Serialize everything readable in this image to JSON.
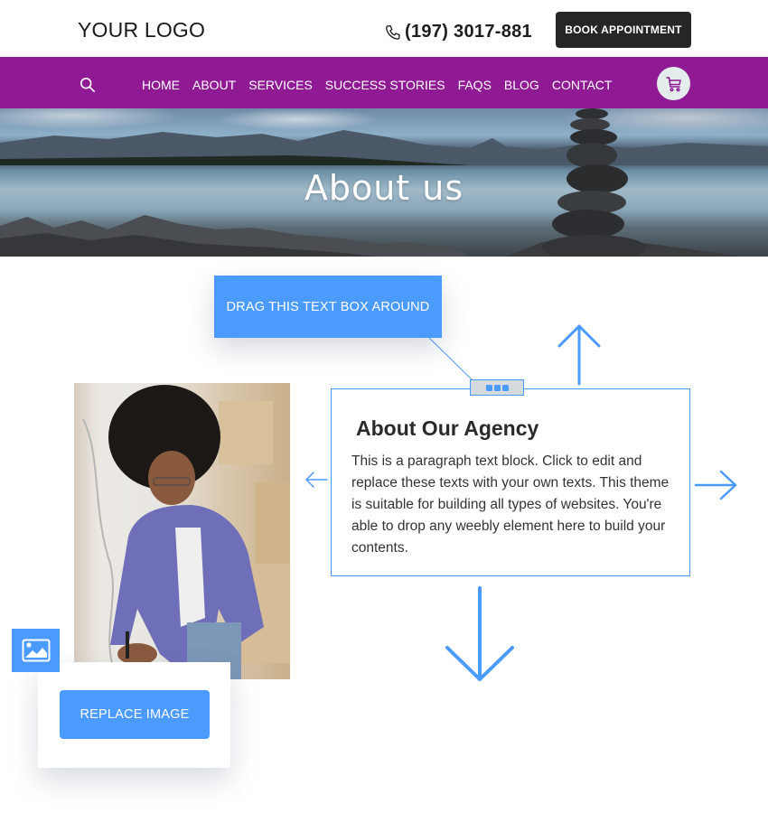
{
  "header": {
    "logo": "YOUR LOGO",
    "phone_icon": "phone-icon",
    "phone": "(197) 3017-881",
    "book_button": "BOOK APPOINTMENT"
  },
  "nav": {
    "search_icon": "search-icon",
    "items": [
      {
        "label": "HOME",
        "active": false
      },
      {
        "label": "ABOUT",
        "active": true
      },
      {
        "label": "SERVICES",
        "active": false
      },
      {
        "label": "SUCCESS STORIES",
        "active": false
      },
      {
        "label": "FAQS",
        "active": false
      },
      {
        "label": "BLOG",
        "active": false
      },
      {
        "label": "CONTACT",
        "active": false
      }
    ],
    "cart_icon": "cart-icon"
  },
  "banner": {
    "title": "About us"
  },
  "tutorial": {
    "drag_hint": "DRAG THIS TEXT BOX AROUND",
    "replace_image": "REPLACE IMAGE",
    "arrows": [
      "arrow-up-icon",
      "arrow-left-icon",
      "arrow-right-icon",
      "arrow-down-icon"
    ]
  },
  "content": {
    "title": "About Our Agency",
    "paragraph": "This is a paragraph text block. Click to edit and replace these texts with your own texts. This theme is suitable for building all types of websites. You're able to drop any weebly element here to build your contents."
  },
  "colors": {
    "nav_purple": "#8f1a94",
    "accent_blue": "#4b9bff",
    "dark_button": "#262626"
  }
}
